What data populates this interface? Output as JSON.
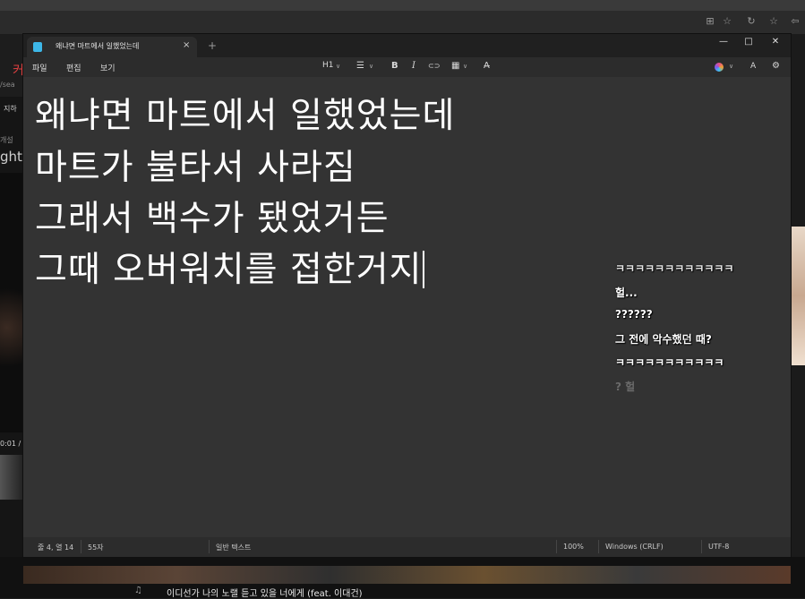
{
  "browser": {
    "toolbar_icons": [
      "extensions-icon",
      "favorite-icon",
      "refresh-icon",
      "favorites-bar-icon",
      "share-icon"
    ]
  },
  "background_page": {
    "left_snippets": [
      "커",
      "/sea",
      "지하",
      "개설",
      "ghts",
      "0:01 /"
    ],
    "bottom_now_playing": "이디선가 나의 노랠 듣고 있을 너에게 (feat. 이대건)"
  },
  "notepad": {
    "tab_title": "왜냐면 마트에서 일했었는데",
    "tab_close": "×",
    "tab_add": "+",
    "window_buttons": {
      "minimize": "—",
      "maximize": "□",
      "close": "✕"
    },
    "menu": {
      "file": "파일",
      "edit": "편집",
      "view": "보기"
    },
    "toolbar": {
      "heading": "H1",
      "list": "☰",
      "bold": "B",
      "italic": "I",
      "link": "⊂⊃",
      "table": "▦",
      "clear_format": "A̶",
      "profile": "A",
      "settings": "⚙",
      "chevron": "∨"
    },
    "lines": [
      "왜냐면 마트에서 일했었는데",
      "마트가 불타서 사라짐",
      "그래서 백수가 됐었거든",
      "그때 오버워치를 접한거지"
    ],
    "status": {
      "position": "줄 4, 열 14",
      "chars": "55자",
      "format": "일반 텍스트",
      "zoom": "100%",
      "line_ending": "Windows (CRLF)",
      "encoding": "UTF-8"
    }
  },
  "chat": {
    "messages": [
      "ㅋㅋㅋㅋㅋㅋㅋㅋㅋㅋㅋㅋ",
      "헐...",
      "??????",
      "그 전에 악수했던 때?",
      "ㅋㅋㅋㅋㅋㅋㅋㅋㅋㅋㅋ",
      "? 헐"
    ]
  },
  "colors": {
    "editor_bg": "#333333",
    "chrome_bg": "#2c2c2c",
    "text": "#ffffff",
    "app_icon": "#3db7e8"
  }
}
